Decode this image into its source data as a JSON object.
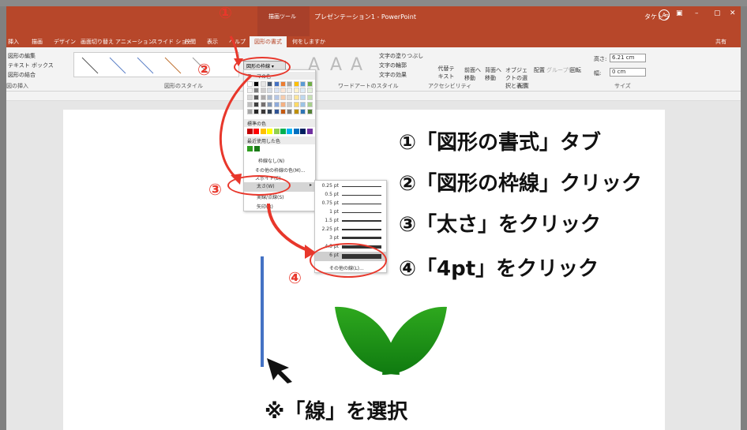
{
  "titlebar": {
    "tool_label": "描画ツール",
    "title": "プレゼンテーション1 - PowerPoint",
    "user": "タケトラ",
    "avatar": "A",
    "window_controls": [
      "▣",
      "–",
      "▢",
      "✕"
    ]
  },
  "tabs": [
    "挿入",
    "描画",
    "デザイン",
    "画面切り替え",
    "アニメーション",
    "スライド ショー",
    "校閲",
    "表示",
    "ヘルプ",
    "図形の書式",
    "何をしますか"
  ],
  "share": "共有",
  "ribbon": {
    "left_items": [
      "図形の編集",
      "テキスト ボックス",
      "図形の結合"
    ],
    "left_label": "図の挿入",
    "styles_label": "図形のスタイル",
    "outline_button": "図形の枠線",
    "wordart_items": [
      "文字の塗りつぶし",
      "文字の輪郭",
      "文字の効果"
    ],
    "wordart_label": "ワードアートのスタイル",
    "accessibility": "代替テキスト",
    "accessibility_label": "アクセシビリティ",
    "arrange_items": [
      "前面へ移動",
      "背面へ移動",
      "オブジェクトの選択と表示",
      "配置",
      "グループ化",
      "回転"
    ],
    "arrange_label": "配置",
    "height_label": "高さ:",
    "height_value": "6.21 cm",
    "width_label": "幅:",
    "width_value": "0 cm",
    "size_label": "サイズ"
  },
  "dropdown": {
    "theme_header": "テーマの色",
    "standard_header": "標準の色",
    "recent_header": "最近使用した色",
    "no_outline": "枠線なし(N)",
    "more_colors": "その他の枠線の色(M)...",
    "eyedropper": "スポイト(E)",
    "weight": "太さ(W)",
    "dashes": "実線/点線(S)",
    "arrows": "矢印(R)"
  },
  "submenu": {
    "weights": [
      "0.25 pt",
      "0.5 pt",
      "0.75 pt",
      "1 pt",
      "1.5 pt",
      "2.25 pt",
      "3 pt",
      "4.5 pt",
      "6 pt"
    ],
    "selected": "6 pt",
    "more": "その他の線(L)..."
  },
  "steps": [
    "①「図形の書式」タブ",
    "②「図形の枠線」クリック",
    "③「太さ」をクリック",
    "④「4pt」をクリック"
  ],
  "markers": [
    "①",
    "②",
    "③",
    "④"
  ],
  "note": "※「線」を選択",
  "colors": {
    "accent": "#b7472a",
    "annotation": "#e8372b",
    "line": "#4472c4",
    "leaf": "#2e9e1f"
  }
}
